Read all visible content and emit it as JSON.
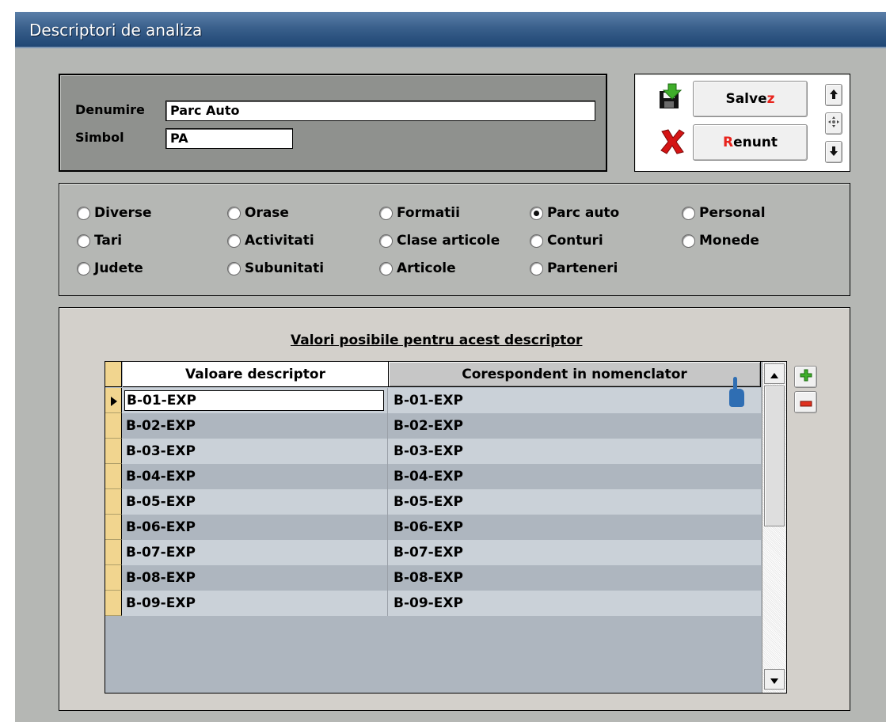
{
  "window": {
    "title": "Descriptori de analiza"
  },
  "form": {
    "denumire_label": "Denumire",
    "denumire_value": "Parc Auto",
    "simbol_label": "Simbol",
    "simbol_value": "PA"
  },
  "actions": {
    "save_label_main": "Salve",
    "save_label_accent": "z",
    "cancel_label_accent": "R",
    "cancel_label_main": "enunt"
  },
  "radio_options": [
    {
      "label": "Diverse",
      "selected": false
    },
    {
      "label": "Orase",
      "selected": false
    },
    {
      "label": "Formatii",
      "selected": false
    },
    {
      "label": "Parc auto",
      "selected": true
    },
    {
      "label": "Personal",
      "selected": false
    },
    {
      "label": "Tari",
      "selected": false
    },
    {
      "label": "Activitati",
      "selected": false
    },
    {
      "label": "Clase articole",
      "selected": false
    },
    {
      "label": "Conturi",
      "selected": false
    },
    {
      "label": "Monede",
      "selected": false
    },
    {
      "label": "Judete",
      "selected": false
    },
    {
      "label": "Subunitati",
      "selected": false
    },
    {
      "label": "Articole",
      "selected": false
    },
    {
      "label": "Parteneri",
      "selected": false
    }
  ],
  "values_section": {
    "title": "Valori posibile pentru acest descriptor",
    "columns": [
      "Valoare descriptor",
      "Corespondent in nomenclator"
    ],
    "rows": [
      [
        "B-01-EXP",
        "B-01-EXP"
      ],
      [
        "B-02-EXP",
        "B-02-EXP"
      ],
      [
        "B-03-EXP",
        "B-03-EXP"
      ],
      [
        "B-04-EXP",
        "B-04-EXP"
      ],
      [
        "B-05-EXP",
        "B-05-EXP"
      ],
      [
        "B-06-EXP",
        "B-06-EXP"
      ],
      [
        "B-07-EXP",
        "B-07-EXP"
      ],
      [
        "B-08-EXP",
        "B-08-EXP"
      ],
      [
        "B-09-EXP",
        "B-09-EXP"
      ]
    ]
  },
  "colors": {
    "accent_red": "#e8231c",
    "add_green": "#3fae2a",
    "remove_red": "#e0311f",
    "row_indicator": "#f1d58f"
  }
}
